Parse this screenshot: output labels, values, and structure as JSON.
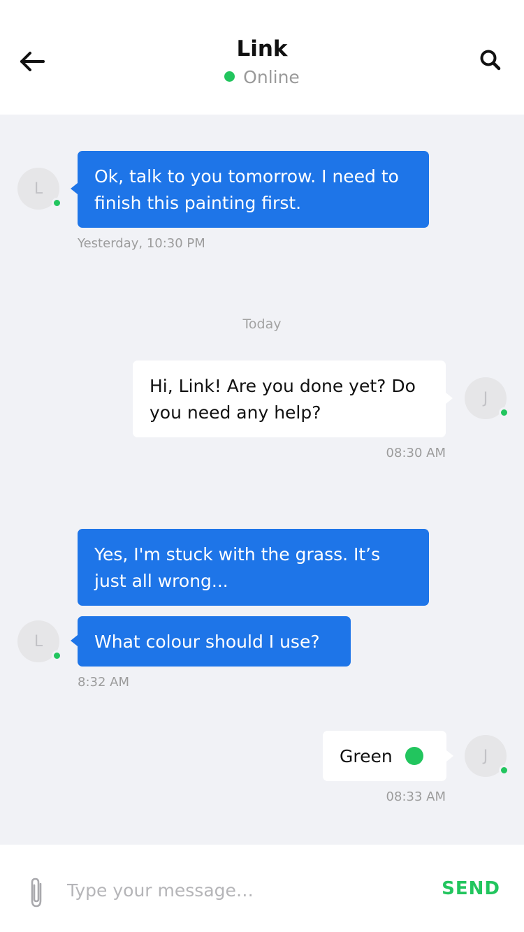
{
  "header": {
    "contact_name": "Link",
    "status_text": "Online",
    "back_icon": "arrow-left-icon",
    "search_icon": "search-icon"
  },
  "messages": [
    {
      "sender": "Link",
      "direction": "incoming",
      "avatar_initial": "L",
      "text": "Ok, talk to you tomorrow. I need to finish this painting first.",
      "timestamp": "Yesterday, 10:30 PM"
    },
    {
      "day_divider": "Today"
    },
    {
      "sender": "me",
      "direction": "outgoing",
      "avatar_initial": "J",
      "text": "Hi, Link! Are you done yet? Do you need any help?",
      "timestamp": "08:30 AM"
    },
    {
      "sender": "Link",
      "direction": "incoming",
      "text": "Yes, I'm stuck with the grass. It’s just all wrong..."
    },
    {
      "sender": "Link",
      "direction": "incoming",
      "avatar_initial": "L",
      "text": "What colour should I use?",
      "timestamp": "8:32 AM"
    },
    {
      "sender": "me",
      "direction": "outgoing",
      "avatar_initial": "J",
      "text": "Green",
      "timestamp": "08:33 AM",
      "swatch_color": "#22c55e"
    }
  ],
  "composer": {
    "placeholder": "Type your message…",
    "value": "",
    "send_label": "SEND",
    "attach_icon": "paperclip-icon"
  },
  "colors": {
    "accent_blue": "#1e75e8",
    "online_green": "#22c55e",
    "background": "#f1f2f6"
  }
}
